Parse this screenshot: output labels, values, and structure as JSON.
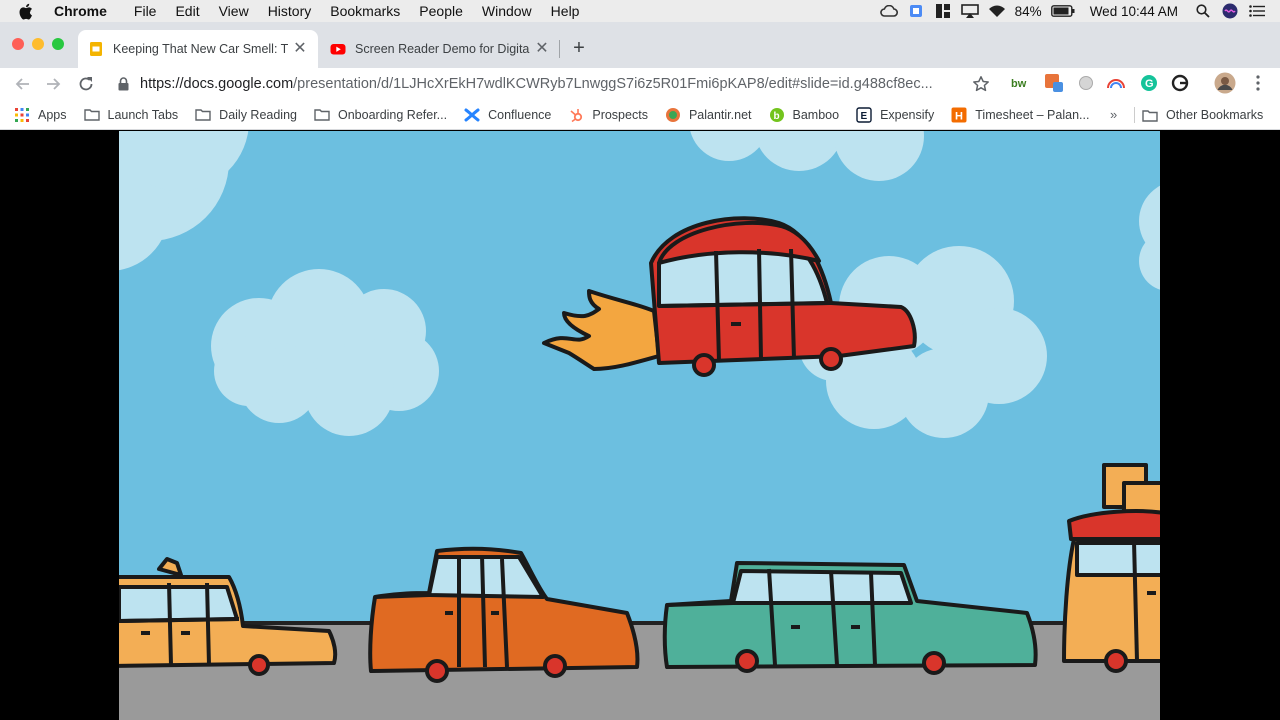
{
  "menubar": {
    "app_name": "Chrome",
    "items": [
      "File",
      "Edit",
      "View",
      "History",
      "Bookmarks",
      "People",
      "Window",
      "Help"
    ],
    "battery": "84%",
    "clock": "Wed 10:44 AM"
  },
  "tabs": [
    {
      "title": "Keeping That New Car Smell: T",
      "favicon": "google-slides-icon",
      "active": true
    },
    {
      "title": "Screen Reader Demo for Digita",
      "favicon": "youtube-icon",
      "active": false
    }
  ],
  "toolbar": {
    "url_host": "https://docs.google.com",
    "url_path": "/presentation/d/1LJHcXrEkH7wdlKCWRyb7LnwggS7i6z5R01Fmi6pKAP8/edit#slide=id.g488cf8ec..."
  },
  "bookmarks": [
    {
      "label": "Apps",
      "icon": "apps-grid-icon"
    },
    {
      "label": "Launch Tabs",
      "icon": "folder-icon"
    },
    {
      "label": "Daily Reading",
      "icon": "folder-icon"
    },
    {
      "label": "Onboarding Refer...",
      "icon": "folder-icon"
    },
    {
      "label": "Confluence",
      "icon": "confluence-icon"
    },
    {
      "label": "Prospects",
      "icon": "hubspot-icon"
    },
    {
      "label": "Palantir.net",
      "icon": "palantir-icon"
    },
    {
      "label": "Bamboo",
      "icon": "bamboo-icon"
    },
    {
      "label": "Expensify",
      "icon": "expensify-icon"
    },
    {
      "label": "Timesheet – Palan...",
      "icon": "harvest-icon"
    }
  ],
  "bookmarks_more": "»",
  "other_bookmarks": "Other Bookmarks",
  "colors": {
    "sky": "#6cbfe0",
    "cloud": "#bde3f0",
    "road": "#9a9a9a",
    "flying_car": "#d9352b",
    "taxi": "#f3ae55",
    "orange_car": "#e06a22",
    "teal_car": "#4fb09a"
  }
}
